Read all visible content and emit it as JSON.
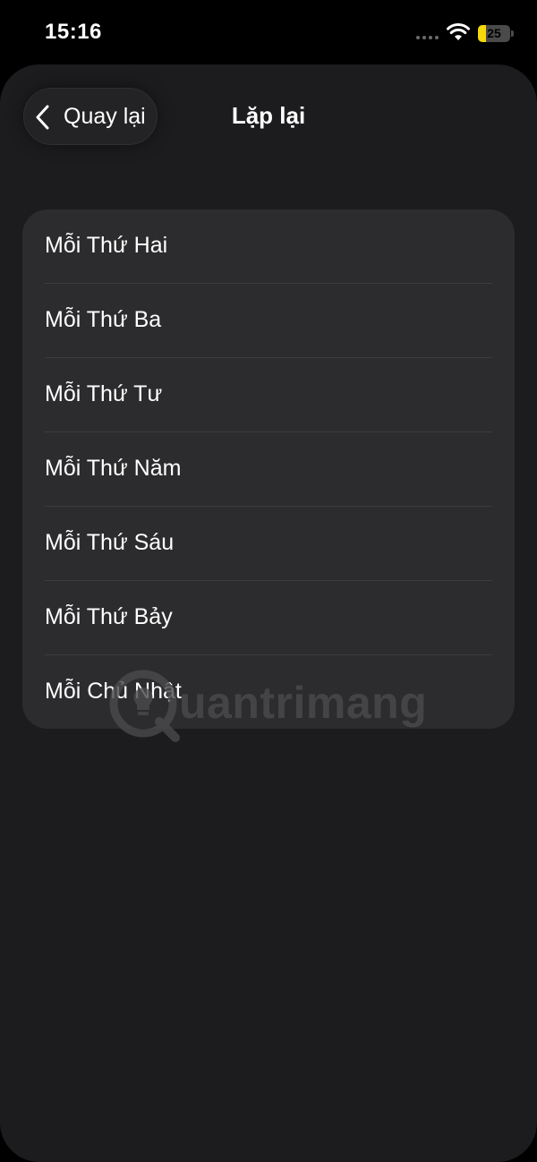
{
  "status_bar": {
    "time": "15:16",
    "battery_level": "25",
    "icons": [
      "signal-dots-icon",
      "wifi-icon",
      "battery-icon"
    ],
    "battery_color": "#f5d90a"
  },
  "header": {
    "back_label": "Quay lại",
    "title": "Lặp lại"
  },
  "repeat_options": [
    {
      "label": "Mỗi Thứ Hai"
    },
    {
      "label": "Mỗi Thứ Ba"
    },
    {
      "label": "Mỗi Thứ Tư"
    },
    {
      "label": "Mỗi Thứ Năm"
    },
    {
      "label": "Mỗi Thứ Sáu"
    },
    {
      "label": "Mỗi Thứ Bảy"
    },
    {
      "label": "Mỗi Chủ Nhật"
    }
  ],
  "watermark": {
    "text": "uantrimang"
  },
  "colors": {
    "background": "#000000",
    "sheet": "#1c1c1e",
    "card": "#2c2c2e",
    "text": "#ffffff"
  }
}
